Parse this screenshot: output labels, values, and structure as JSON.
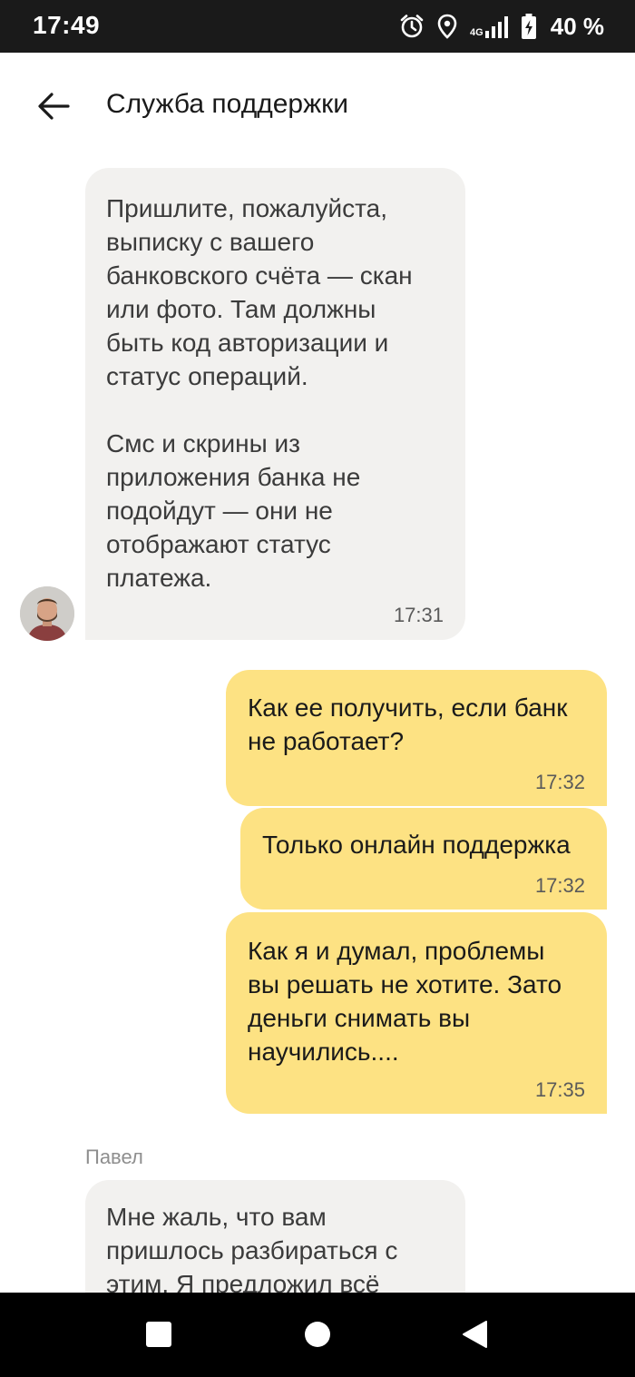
{
  "status_bar": {
    "time": "17:49",
    "network": "4G",
    "battery": "40 %",
    "icons": [
      "alarm-icon",
      "location-icon",
      "signal-icon",
      "battery-charging-icon"
    ]
  },
  "header": {
    "title": "Служба поддержки",
    "back_icon": "arrow-left-icon"
  },
  "messages": [
    {
      "direction": "incoming",
      "text": "Пришлите, пожалуйста,\nвыписку с вашего\nбанковского счёта — скан\nили фото. Там должны\nбыть код авторизации и\nстатус операций.\n\nСмс и скрины из\nприложения банка не\nподойдут — они не\nотображают статус\nплатежа.",
      "time": "17:31"
    },
    {
      "direction": "outgoing",
      "text": "Как ее получить, если банк\nне работает?",
      "time": "17:32"
    },
    {
      "direction": "outgoing",
      "text": "Только онлайн поддержка",
      "time": "17:32"
    },
    {
      "direction": "outgoing",
      "text": "Как я и думал, проблемы\nвы решать не хотите. Зато\nденьги снимать вы\nнаучились....",
      "time": "17:35"
    },
    {
      "direction": "incoming",
      "sender": "Павел",
      "text": "Мне жаль, что вам\nпришлось разбираться с\nэтим. Я предложил всё"
    }
  ],
  "nav_bar": {
    "buttons": [
      "recents-square-icon",
      "home-circle-icon",
      "back-triangle-icon"
    ]
  },
  "colors": {
    "incoming_bubble": "#f2f1ef",
    "outgoing_bubble": "#fde283",
    "status_bar": "#1a1a1a",
    "nav_bar": "#000000"
  }
}
